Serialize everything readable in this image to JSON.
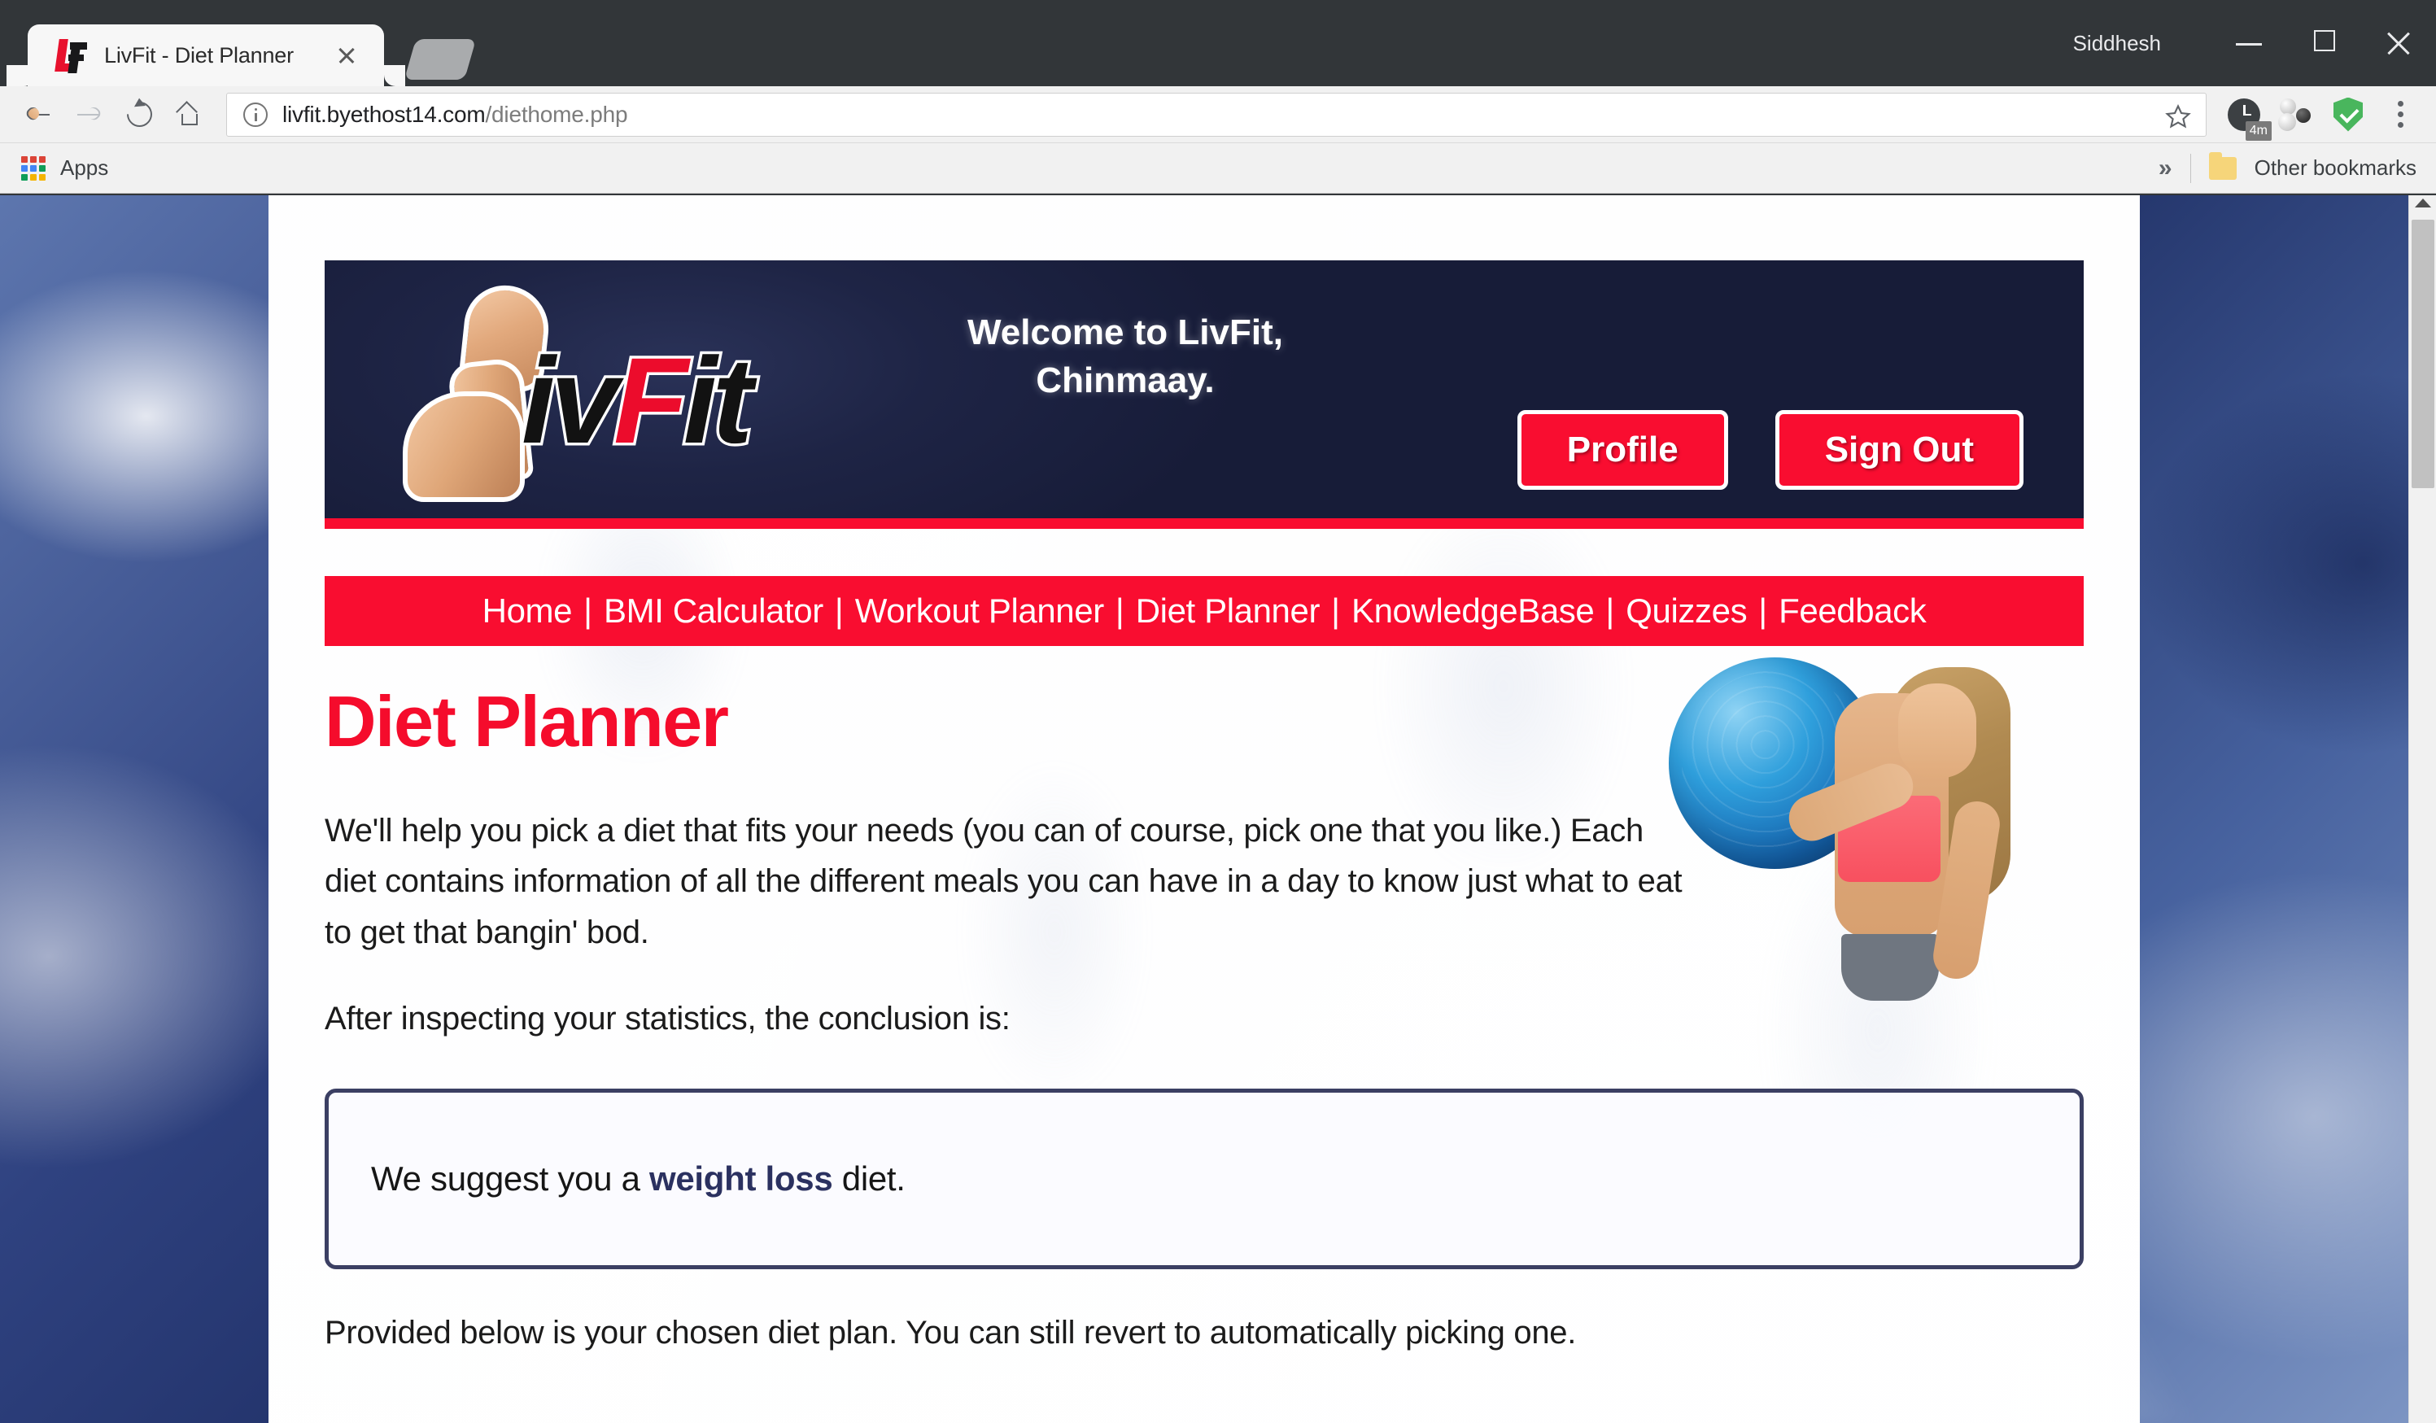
{
  "browser": {
    "tab": {
      "title": "LivFit - Diet Planner",
      "favicon": "livfit-logo-icon",
      "close": "×"
    },
    "new_tab_label": "+",
    "window_user": "Siddhesh",
    "window_controls": {
      "minimize": "−",
      "maximize": "□",
      "close": "×"
    },
    "toolbar": {
      "back": "←",
      "forward": "→",
      "reload": "⟳",
      "home": "⌂",
      "url_host": "livfit.byethost14.com",
      "url_path": "/diethome.php",
      "bookmark_star": "☆",
      "extensions": [
        {
          "name": "timer-extension",
          "badge": "4m"
        },
        {
          "name": "molecule-extension",
          "badge": ""
        },
        {
          "name": "adguard-shield-extension",
          "badge": ""
        }
      ],
      "menu": "⋮"
    },
    "bookmarks_bar": {
      "apps_label": "Apps",
      "overflow": "»",
      "other_bookmarks": "Other bookmarks"
    }
  },
  "page": {
    "header": {
      "logo_text_parts": [
        "iv",
        "F",
        "it"
      ],
      "welcome_line1": "Welcome to LivFit,",
      "welcome_line2": "Chinmaay.",
      "profile_button": "Profile",
      "signout_button": "Sign Out"
    },
    "nav": {
      "items": [
        "Home",
        "BMI Calculator",
        "Workout Planner",
        "Diet Planner",
        "KnowledgeBase",
        "Quizzes",
        "Feedback"
      ],
      "separator": "|"
    },
    "title": "Diet Planner",
    "intro_paragraph": "We'll help you pick a diet that fits your needs (you can of course, pick one that you like.) Each diet contains information of all the different meals you can have in a day to know just what to eat to get that bangin' bod.",
    "conclusion_lead": "After inspecting your statistics, the conclusion is:",
    "suggestion": {
      "prefix": "We suggest you a ",
      "diet_type": "weight loss",
      "suffix": " diet."
    },
    "footer_note": "Provided below is your chosen diet plan. You can still revert to automatically picking one.",
    "hero_image": "fitness-model-with-exercise-ball"
  },
  "colors": {
    "brand_red": "#f90d30",
    "header_navy": "#1b2142",
    "suggest_border": "#3b3f63",
    "suggest_accent": "#2b3160"
  }
}
